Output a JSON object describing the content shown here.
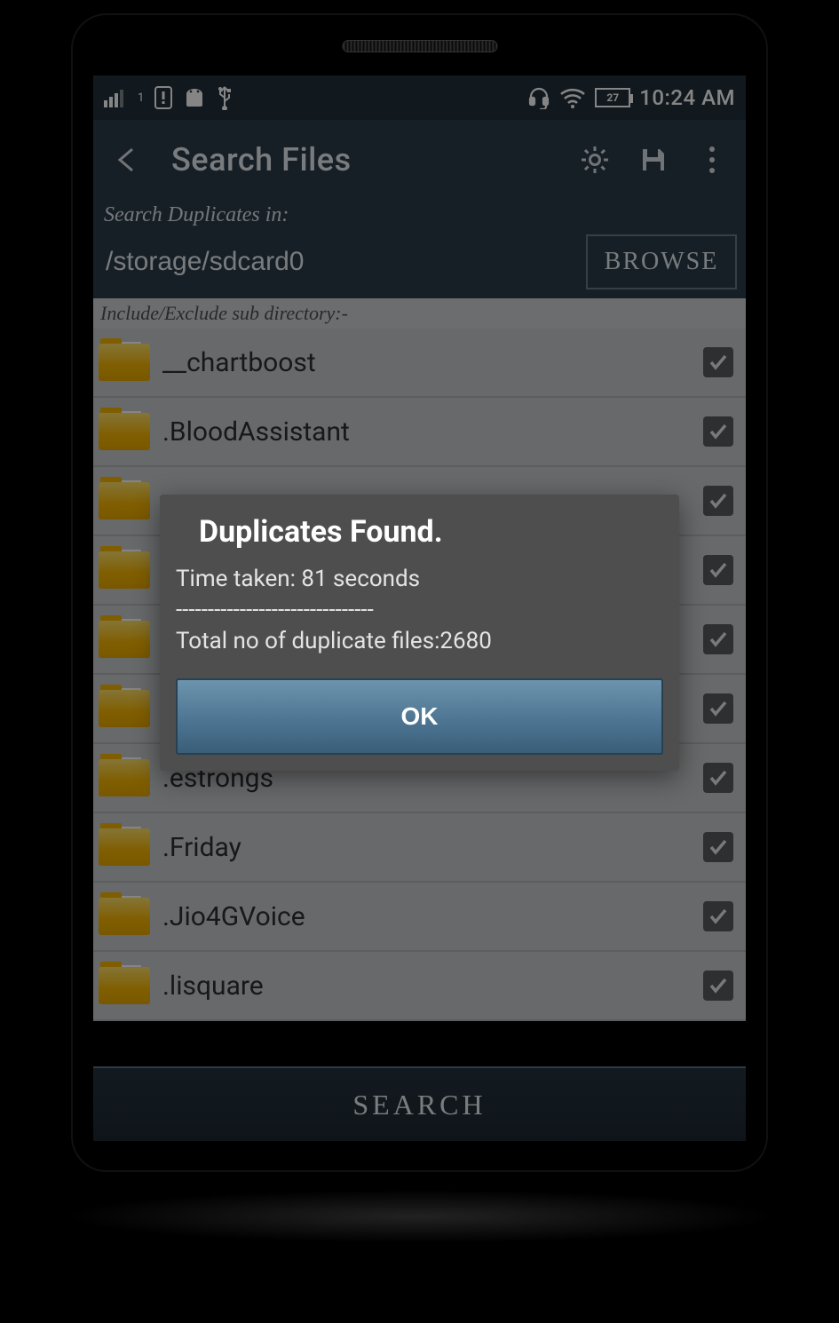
{
  "status": {
    "battery_level": "27",
    "clock": "10:24 AM"
  },
  "appbar": {
    "title": "Search Files"
  },
  "search": {
    "label": "Search Duplicates in:",
    "path": "/storage/sdcard0",
    "browse_label": "BROWSE"
  },
  "sublabel": "Include/Exclude sub directory:-",
  "folders": [
    {
      "name": "__chartboost",
      "checked": true
    },
    {
      "name": ".BloodAssistant",
      "checked": true
    },
    {
      "name": "",
      "checked": true
    },
    {
      "name": "",
      "checked": true
    },
    {
      "name": "",
      "checked": true
    },
    {
      "name": "",
      "checked": true
    },
    {
      "name": ".estrongs",
      "checked": true
    },
    {
      "name": ".Friday",
      "checked": true
    },
    {
      "name": ".Jio4GVoice",
      "checked": true
    },
    {
      "name": ".lisquare",
      "checked": true
    }
  ],
  "search_button": "SEARCH",
  "dialog": {
    "title": "Duplicates Found.",
    "time_line": "Time taken: 81 seconds",
    "separator": "-------------------------------",
    "total_line": "Total no of duplicate files:2680",
    "ok_label": "OK"
  }
}
